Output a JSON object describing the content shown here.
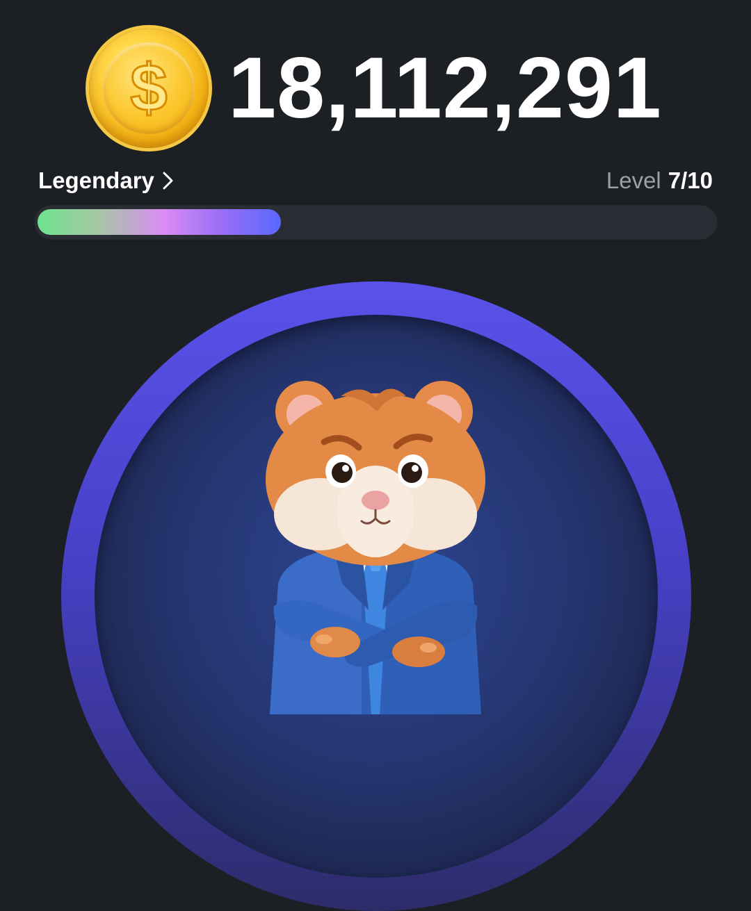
{
  "balance": "18,112,291",
  "rank": {
    "label": "Legendary"
  },
  "level": {
    "label": "Level",
    "value": "7/10"
  },
  "progress": {
    "fraction": 0.36
  },
  "icons": {
    "coin": "dollar-coin-icon",
    "chevron": "chevron-right-icon",
    "mascot": "hamster-ceo-mascot"
  },
  "colors": {
    "background": "#1c1f24",
    "coin": "#f6b818",
    "progress_start": "#6fe38c",
    "progress_mid": "#da8cf4",
    "progress_end": "#5a68ff",
    "ring": "#5a52ea"
  }
}
